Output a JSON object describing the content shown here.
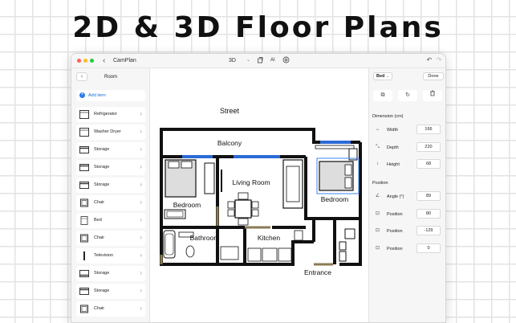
{
  "headline": "2D & 3D Floor Plans",
  "window": {
    "title": "CamPlan",
    "view_mode": "3D",
    "ai_label": "AI"
  },
  "sidebar": {
    "title": "Room",
    "add_item_label": "Add item",
    "items": [
      {
        "label": "Refrigerator",
        "icon": "refrigerator-icon"
      },
      {
        "label": "Washer Dryer",
        "icon": "washer-dryer-icon"
      },
      {
        "label": "Storage",
        "icon": "storage-icon"
      },
      {
        "label": "Storage",
        "icon": "storage-icon"
      },
      {
        "label": "Storage",
        "icon": "storage-icon"
      },
      {
        "label": "Chair",
        "icon": "chair-icon"
      },
      {
        "label": "Bed",
        "icon": "bed-icon"
      },
      {
        "label": "Chair",
        "icon": "chair-icon"
      },
      {
        "label": "Television",
        "icon": "television-icon"
      },
      {
        "label": "Storage",
        "icon": "storage-icon"
      },
      {
        "label": "Storage",
        "icon": "storage-icon"
      },
      {
        "label": "Chair",
        "icon": "chair-icon"
      }
    ]
  },
  "floorplan": {
    "labels": {
      "street": "Street",
      "balcony": "Balcony",
      "living_room": "Living Room",
      "bedroom_left": "Bedroom",
      "bedroom_right": "Bedroom",
      "bathroom": "Bathroom",
      "kitchen": "Kitchen",
      "entrance": "Entrance"
    },
    "colors": {
      "wall": "#111111",
      "window": "#2b6bd6",
      "door": "#8a7a55",
      "selection": "#3b82f6"
    }
  },
  "panel": {
    "selected_object": "Bed",
    "done_label": "Done",
    "dimension_heading": "Dimension (cm)",
    "dimensions": [
      {
        "label": "Width",
        "value": "166"
      },
      {
        "label": "Depth",
        "value": "220"
      },
      {
        "label": "Height",
        "value": "68"
      }
    ],
    "position_heading": "Position",
    "positions": [
      {
        "label": "Angle (°)",
        "value": "89"
      },
      {
        "label": "Position",
        "value": "80"
      },
      {
        "label": "Position",
        "value": "-129"
      },
      {
        "label": "Position",
        "value": "0"
      }
    ]
  }
}
